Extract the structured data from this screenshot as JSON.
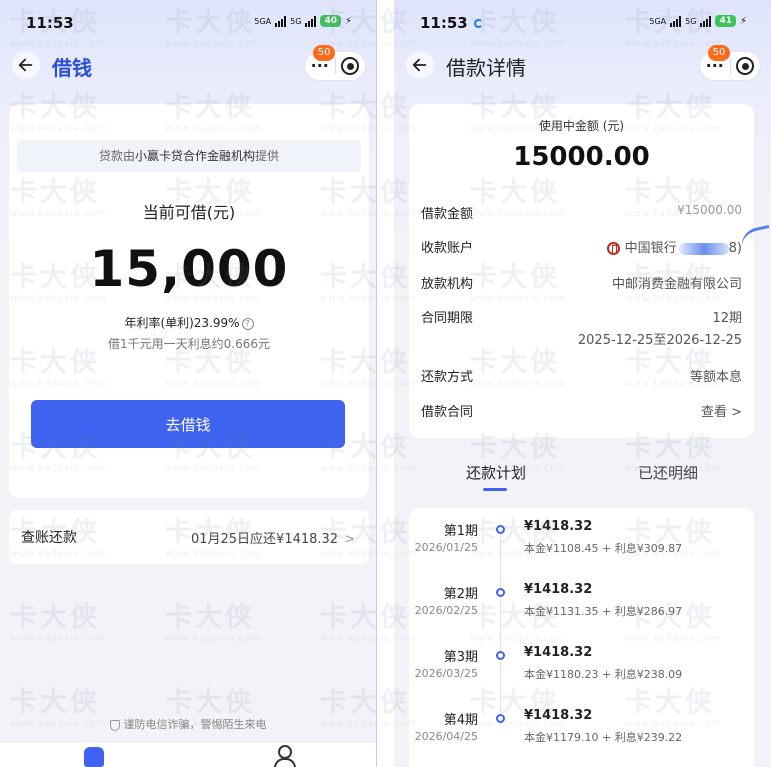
{
  "left": {
    "status": {
      "time": "11:53",
      "net1": "5GA",
      "net2": "5G",
      "battery": "40"
    },
    "nav": {
      "title": "借钱",
      "more": "···",
      "badge": "50"
    },
    "provider": {
      "prefix": "贷款由",
      "name": "小赢卡贷合作金融机构",
      "suffix": "提供"
    },
    "available_label": "当前可借(元)",
    "available_amount": "15,000",
    "rate": "年利率(单利)23.99%",
    "interest_note": "借1千元用一天利息约0.666元",
    "borrow_button": "去借钱",
    "repay": {
      "label": "查账还款",
      "due": "01月25日应还¥1418.32"
    },
    "anti_fraud": "谨防电信诈骗，警惕陌生来电"
  },
  "right": {
    "status": {
      "time": "11:53",
      "net1": "5GA",
      "net2": "5G",
      "battery": "41"
    },
    "nav": {
      "title": "借款详情",
      "more": "···",
      "badge": "50"
    },
    "used_label": "使用中金额 (元)",
    "used_amount": "15000.00",
    "rows": {
      "loan_amount": {
        "label": "借款金额",
        "value": "¥15000.00"
      },
      "account": {
        "label": "收款账户",
        "value": "中国银行",
        "tail": "8)"
      },
      "lender": {
        "label": "放款机构",
        "value": "中邮消费金融有限公司"
      },
      "term": {
        "label": "合同期限",
        "value": "12期",
        "range": "2025-12-25至2026-12-25"
      },
      "method": {
        "label": "还款方式",
        "value": "等额本息"
      },
      "contract": {
        "label": "借款合同",
        "value": "查看"
      }
    },
    "tabs": {
      "plan": "还款计划",
      "paid": "已还明细"
    },
    "plan": [
      {
        "term": "第1期",
        "date": "2026/01/25",
        "amount": "¥1418.32",
        "breakdown": "本金¥1108.45 + 利息¥309.87"
      },
      {
        "term": "第2期",
        "date": "2026/02/25",
        "amount": "¥1418.32",
        "breakdown": "本金¥1131.35 + 利息¥286.97"
      },
      {
        "term": "第3期",
        "date": "2026/03/25",
        "amount": "¥1418.32",
        "breakdown": "本金¥1180.23 + 利息¥238.09"
      },
      {
        "term": "第4期",
        "date": "2026/04/25",
        "amount": "¥1418.32",
        "breakdown": "本金¥1179.10 + 利息¥239.22"
      }
    ]
  },
  "watermark": {
    "brand": "卡大侠",
    "url": "www.kadaxia.com"
  },
  "colors": {
    "primary": "#3d63f0",
    "title_blue": "#2b50d6",
    "badge": "#ff6a1a",
    "battery": "#3ec25c",
    "bank_red": "#c8261d"
  },
  "icons": {
    "back": "arrow-left-icon",
    "more": "more-dots-icon",
    "close": "target-close-icon",
    "info": "question-circle-icon",
    "shield": "shield-icon",
    "home": "home-icon",
    "user": "user-icon",
    "bank": "bank-of-china-icon",
    "chevron": "chevron-right-icon"
  }
}
